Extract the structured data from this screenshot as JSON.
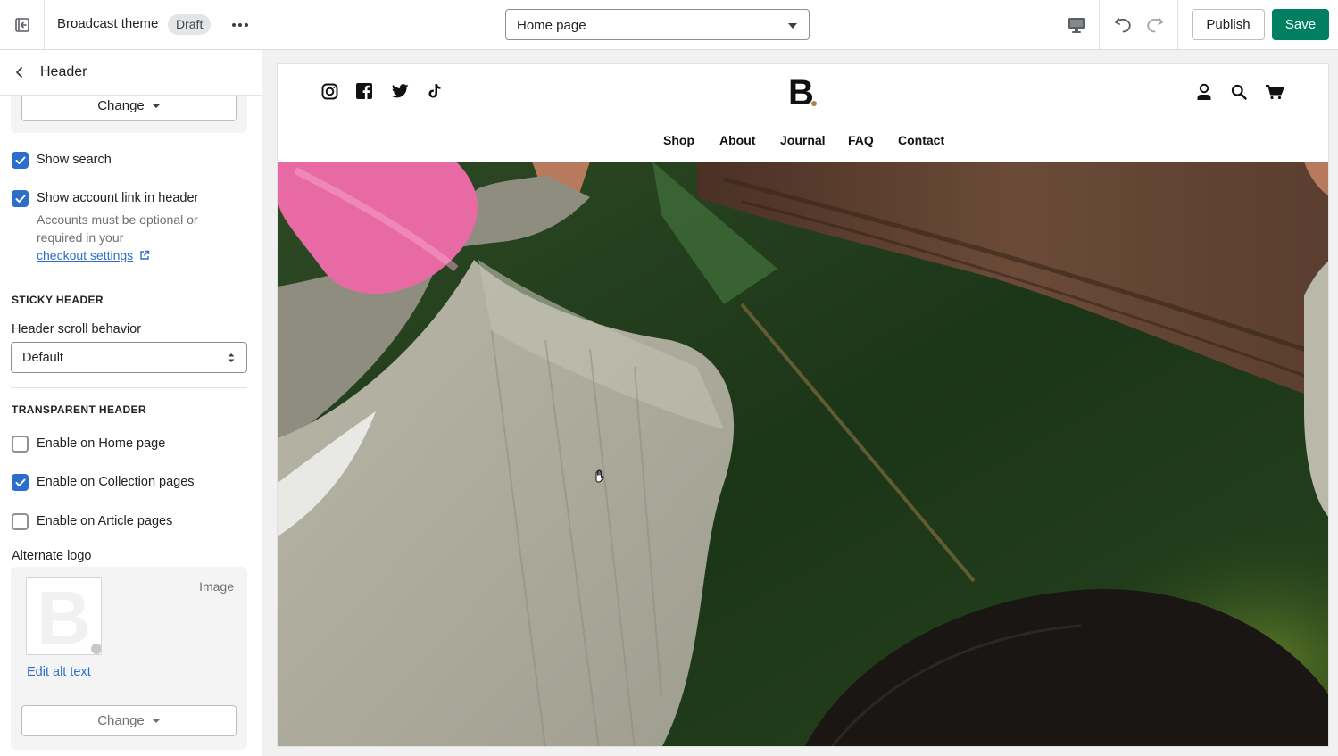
{
  "topbar": {
    "theme_name": "Broadcast theme",
    "status_badge": "Draft",
    "page_select": "Home page",
    "publish_label": "Publish",
    "save_label": "Save",
    "colors": {
      "save": "#008060"
    }
  },
  "sidebar": {
    "title": "Header",
    "logo_change_label": "Change",
    "show_search": {
      "label": "Show search",
      "checked": true
    },
    "show_account": {
      "label": "Show account link in header",
      "checked": true,
      "help": "Accounts must be optional or required in your",
      "help_link": "checkout settings"
    },
    "sticky": {
      "heading": "STICKY HEADER",
      "scroll_label": "Header scroll behavior",
      "scroll_value": "Default"
    },
    "transparent": {
      "heading": "TRANSPARENT HEADER",
      "home": {
        "label": "Enable on Home page",
        "checked": false
      },
      "collection": {
        "label": "Enable on Collection pages",
        "checked": true
      },
      "article": {
        "label": "Enable on Article pages",
        "checked": false
      }
    },
    "alt_logo": {
      "label": "Alternate logo",
      "image_label": "Image",
      "edit_alt_text": "Edit alt text",
      "change_label": "Change"
    }
  },
  "preview": {
    "brand": "B",
    "social_icons": [
      "instagram-icon",
      "facebook-icon",
      "twitter-icon",
      "tiktok-icon"
    ],
    "header_icons": [
      "account-icon",
      "search-icon",
      "cart-icon"
    ],
    "nav": [
      "Shop",
      "About",
      "Journal",
      "FAQ",
      "Contact"
    ]
  }
}
